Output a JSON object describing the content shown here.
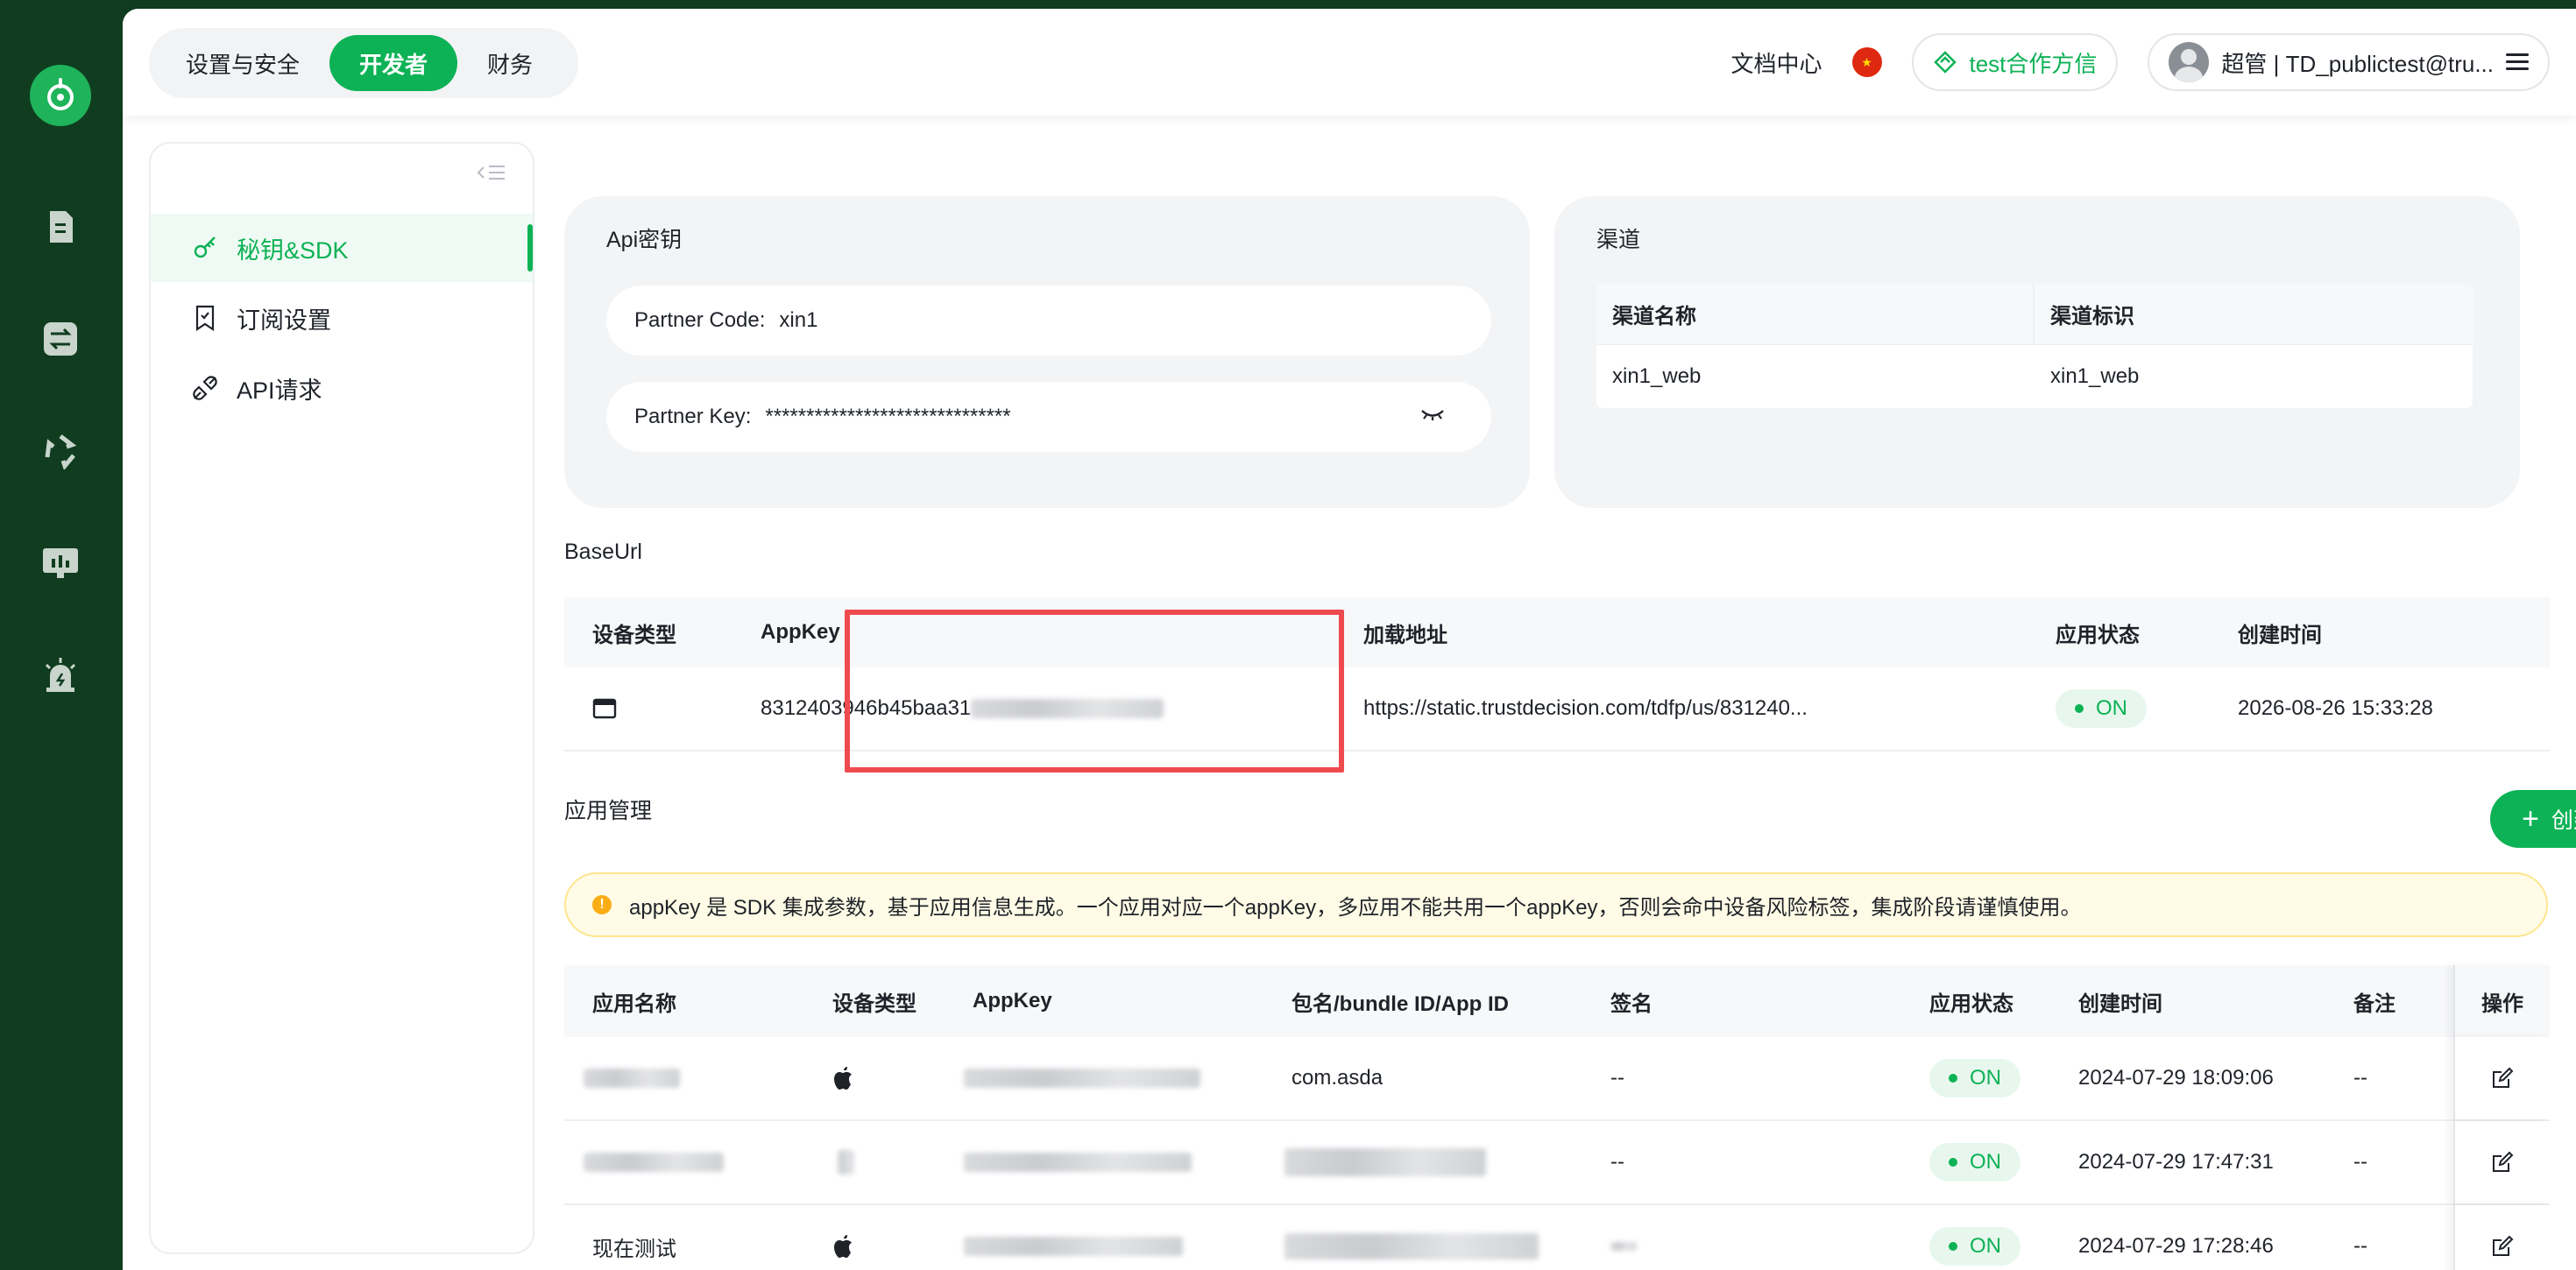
{
  "rail": {
    "items": [
      "logo-icon",
      "document-icon",
      "swap-icon",
      "refresh-icon",
      "monitor-icon",
      "alarm-icon"
    ]
  },
  "header": {
    "tabs": [
      {
        "label": "设置与安全",
        "active": false
      },
      {
        "label": "开发者",
        "active": true
      },
      {
        "label": "财务",
        "active": false
      }
    ],
    "docs_label": "文档中心",
    "partner_label": "test合作方信",
    "user_label": "超管 | TD_publictest@tru..."
  },
  "sidebar": {
    "items": [
      {
        "label": "秘钥&SDK",
        "icon": "key-icon",
        "active": true
      },
      {
        "label": "订阅设置",
        "icon": "bookmark-icon",
        "active": false
      },
      {
        "label": "API请求",
        "icon": "plug-icon",
        "active": false
      }
    ]
  },
  "api_key": {
    "title": "Api密钥",
    "partner_code_label": "Partner Code:",
    "partner_code_value": "xin1",
    "partner_key_label": "Partner Key:",
    "partner_key_value": "******************************"
  },
  "channel": {
    "title": "渠道",
    "headers": [
      "渠道名称",
      "渠道标识"
    ],
    "rows": [
      [
        "xin1_web",
        "xin1_web"
      ]
    ]
  },
  "base_url": {
    "title": "BaseUrl",
    "headers": [
      "设备类型",
      "AppKey",
      "加载地址",
      "应用状态",
      "创建时间"
    ],
    "row": {
      "device_icon": "browser-icon",
      "appkey": "8312403946b45baa31",
      "url": "https://static.trustdecision.com/tdfp/us/831240...",
      "status": "ON",
      "created": "2026-08-26 15:33:28"
    }
  },
  "app_management": {
    "title": "应用管理",
    "create_label": "创建应用",
    "notice": "appKey 是 SDK 集成参数，基于应用信息生成。一个应用对应一个appKey，多应用不能共用一个appKey，否则会命中设备风险标签，集成阶段请谨慎使用。",
    "headers": [
      "应用名称",
      "设备类型",
      "AppKey",
      "包名/bundle ID/App ID",
      "签名",
      "应用状态",
      "创建时间",
      "备注",
      "操作"
    ],
    "rows": [
      {
        "name": "",
        "device": "apple",
        "package": "com.asda",
        "signature": "--",
        "status": "ON",
        "created": "2024-07-29 18:09:06",
        "remark": "--"
      },
      {
        "name": "",
        "device": "android",
        "package": "",
        "signature": "--",
        "status": "ON",
        "created": "2024-07-29 17:47:31",
        "remark": "--"
      },
      {
        "name": "现在测试",
        "device": "apple",
        "package": "",
        "signature": "",
        "status": "ON",
        "created": "2024-07-29 17:28:46",
        "remark": "--"
      }
    ]
  },
  "colors": {
    "brand": "#0cb255",
    "rail": "#103d1f",
    "highlight": "#ef4a50"
  }
}
